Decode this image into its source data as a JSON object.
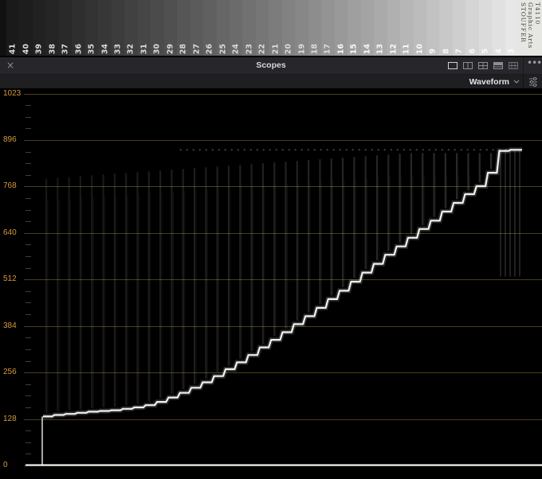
{
  "wedge": {
    "step_labels": [
      "41",
      "40",
      "39",
      "38",
      "37",
      "36",
      "35",
      "34",
      "33",
      "32",
      "31",
      "30",
      "29",
      "28",
      "27",
      "26",
      "25",
      "24",
      "23",
      "22",
      "21",
      "20",
      "19",
      "18",
      "17",
      "16",
      "15",
      "14",
      "13",
      "12",
      "11",
      "10",
      "9",
      "8",
      "7",
      "6",
      "5",
      "4",
      "3"
    ],
    "brand_line1": "STOUFFER",
    "brand_line2": "Graphic Arts",
    "brand_line3": "T4110"
  },
  "titlebar": {
    "title": "Scopes",
    "close_label": "×",
    "more_label": "•••",
    "layouts": [
      "single-view-icon",
      "dual-view-icon",
      "quad-view-icon",
      "stacked-view-icon",
      "grid-view-icon"
    ]
  },
  "toolbar": {
    "scope_type": "Waveform"
  },
  "scope": {
    "y_axis_labels": [
      "1023",
      "896",
      "768",
      "640",
      "512",
      "384",
      "256",
      "128",
      "0"
    ],
    "colors": {
      "graticule": "#4a3d1e",
      "label": "#d49a3a",
      "trace": "#f2f2f2"
    }
  },
  "chart_data": {
    "type": "waveform",
    "ylim": [
      0,
      1023
    ],
    "yticks": [
      0,
      128,
      256,
      384,
      512,
      640,
      768,
      896,
      1023
    ],
    "steps": 39,
    "trace_levels": [
      135,
      139,
      142,
      145,
      148,
      150,
      152,
      156,
      160,
      166,
      175,
      187,
      200,
      214,
      229,
      246,
      265,
      284,
      304,
      325,
      346,
      367,
      389,
      411,
      434,
      458,
      481,
      506,
      531,
      555,
      580,
      603,
      627,
      651,
      674,
      699,
      723,
      747,
      769,
      806,
      866,
      869,
      869
    ]
  }
}
